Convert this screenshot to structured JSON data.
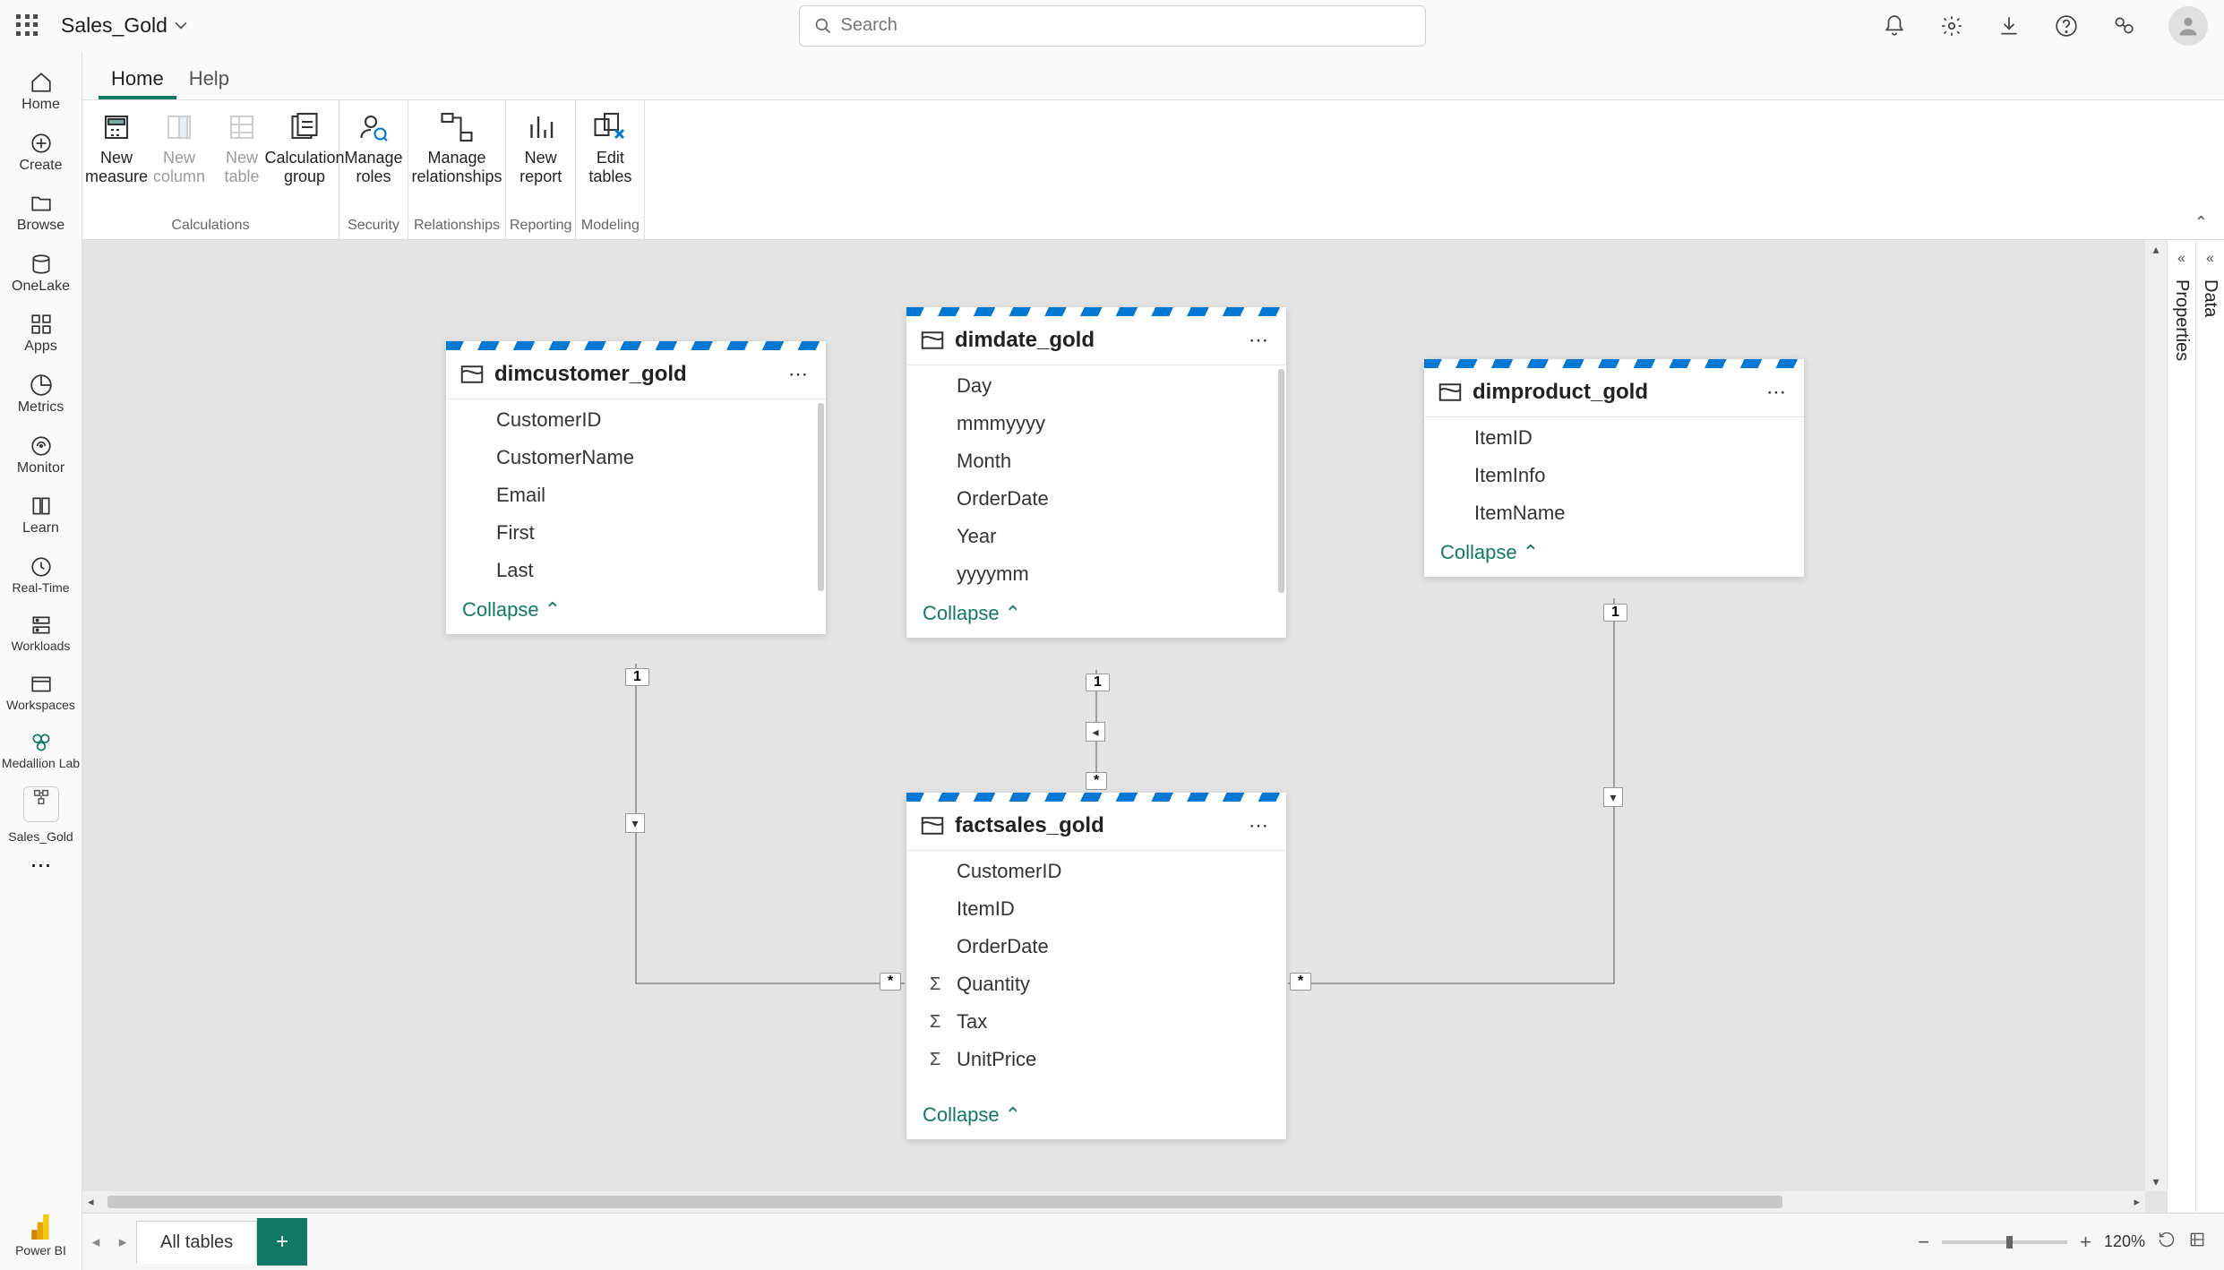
{
  "top": {
    "doc_name": "Sales_Gold",
    "search_placeholder": "Search"
  },
  "rail": {
    "items": [
      {
        "label": "Home"
      },
      {
        "label": "Create"
      },
      {
        "label": "Browse"
      },
      {
        "label": "OneLake"
      },
      {
        "label": "Apps"
      },
      {
        "label": "Metrics"
      },
      {
        "label": "Monitor"
      },
      {
        "label": "Learn"
      },
      {
        "label": "Real-Time"
      },
      {
        "label": "Workloads"
      },
      {
        "label": "Workspaces"
      },
      {
        "label": "Medallion Lab"
      },
      {
        "label": "Sales_Gold"
      }
    ],
    "footer_label": "Power BI"
  },
  "tabs": [
    {
      "label": "Home",
      "active": true
    },
    {
      "label": "Help",
      "active": false
    }
  ],
  "ribbon": {
    "groups": [
      {
        "name": "Calculations",
        "buttons": [
          {
            "label": "New measure"
          },
          {
            "label": "New column"
          },
          {
            "label": "New table"
          },
          {
            "label": "Calculation group"
          }
        ]
      },
      {
        "name": "Security",
        "buttons": [
          {
            "label": "Manage roles"
          }
        ]
      },
      {
        "name": "Relationships",
        "buttons": [
          {
            "label": "Manage relationships"
          }
        ]
      },
      {
        "name": "Reporting",
        "buttons": [
          {
            "label": "New report"
          }
        ]
      },
      {
        "name": "Modeling",
        "buttons": [
          {
            "label": "Edit tables"
          }
        ]
      }
    ]
  },
  "tables": {
    "dimcustomer": {
      "title": "dimcustomer_gold",
      "collapse": "Collapse",
      "cols": [
        "CustomerID",
        "CustomerName",
        "Email",
        "First",
        "Last"
      ]
    },
    "dimdate": {
      "title": "dimdate_gold",
      "collapse": "Collapse",
      "cols": [
        "Day",
        "mmmyyyy",
        "Month",
        "OrderDate",
        "Year",
        "yyyymm"
      ]
    },
    "dimproduct": {
      "title": "dimproduct_gold",
      "collapse": "Collapse",
      "cols": [
        "ItemID",
        "ItemInfo",
        "ItemName"
      ]
    },
    "factsales": {
      "title": "factsales_gold",
      "collapse": "Collapse",
      "cols": [
        "CustomerID",
        "ItemID",
        "OrderDate",
        "Quantity",
        "Tax",
        "UnitPrice"
      ]
    }
  },
  "rel_labels": {
    "one": "1",
    "many": "*"
  },
  "right_panes": {
    "properties": "Properties",
    "data": "Data"
  },
  "bottom": {
    "tab": "All tables",
    "zoom": "120%"
  }
}
